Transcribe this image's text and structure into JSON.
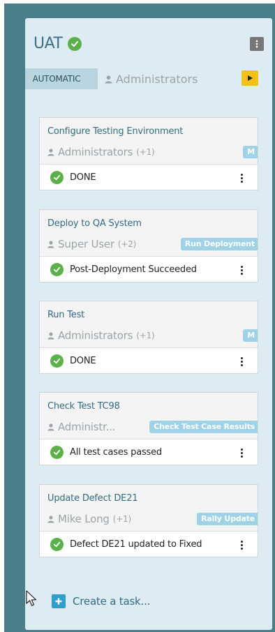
{
  "phase": {
    "title": "UAT",
    "automatic_label": "AUTOMATIC",
    "owner": "Administrators"
  },
  "tasks": [
    {
      "title": "Configure Testing Environment",
      "owner": "Administrators",
      "extra": "(+1)",
      "label": "M",
      "status": "DONE"
    },
    {
      "title": "Deploy to QA System",
      "owner": "Super User",
      "extra": "(+2)",
      "label": "Run Deployment",
      "status": "Post-Deployment Succeeded"
    },
    {
      "title": "Run Test",
      "owner": "Administrators",
      "extra": "(+1)",
      "label": "M",
      "status": "DONE"
    },
    {
      "title": "Check Test TC98",
      "owner": "Administr...",
      "extra": "",
      "label": "Check Test Case Results",
      "status": "All test cases passed"
    },
    {
      "title": "Update Defect DE21",
      "owner": "Mike Long",
      "extra": "(+1)",
      "label": "Rally Update",
      "status": "Defect DE21 updated to Fixed"
    }
  ],
  "create_task_label": "Create a task...",
  "icons": {
    "phase_status": "check-circle-icon",
    "menu": "kebab-menu-icon",
    "owner": "user-icon",
    "play": "play-icon",
    "task_status": "check-circle-icon",
    "add": "plus-icon",
    "cursor": "mouse-pointer-icon"
  },
  "colors": {
    "background": "#4a7f8a",
    "panel": "#dcecf2",
    "success": "#5bb04a",
    "play": "#f2c21b",
    "label": "#9fd2e6",
    "add": "#2f9ec8"
  }
}
